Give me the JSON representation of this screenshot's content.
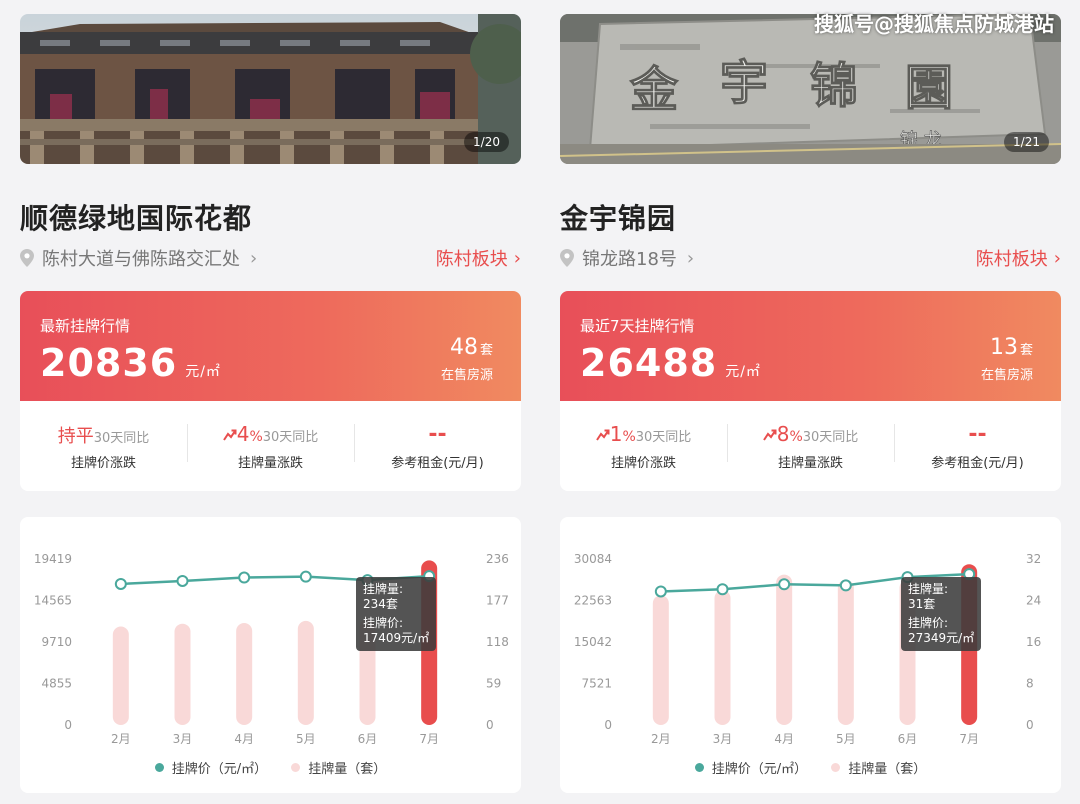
{
  "watermark": "搜狐号@搜狐焦点防城港站",
  "colors": {
    "accent": "#e84e4e",
    "line": "#4aa89c",
    "bar": "#f9d9d8",
    "bar_active": "#e84d4d"
  },
  "listings": [
    {
      "photo_counter": "1/20",
      "name": "顺德绿地国际花都",
      "address": "陈村大道与佛陈路交汇处",
      "district": "陈村板块",
      "stats": {
        "label": "最新挂牌行情",
        "price": "20836",
        "price_unit": "元/㎡",
        "count": "48",
        "count_unit": "套",
        "count_label": "在售房源",
        "metrics": [
          {
            "value": "持平",
            "note": "30天同比",
            "label": "挂牌价涨跌"
          },
          {
            "value": "4",
            "pct": "%",
            "note": "30天同比",
            "label": "挂牌量涨跌"
          },
          {
            "value": "--",
            "label": "参考租金(元/月)"
          }
        ]
      },
      "tooltip": {
        "count_title": "挂牌量:",
        "count_value": "234套",
        "price_title": "挂牌价:",
        "price_value": "17409元/㎡"
      },
      "legend": {
        "price": "挂牌价（元/㎡）",
        "count": "挂牌量（套）"
      }
    },
    {
      "photo_counter": "1/21",
      "name": "金宇锦园",
      "address": "锦龙路18号",
      "district": "陈村板块",
      "stats": {
        "label": "最近7天挂牌行情",
        "price": "26488",
        "price_unit": "元/㎡",
        "count": "13",
        "count_unit": "套",
        "count_label": "在售房源",
        "metrics": [
          {
            "value": "1",
            "pct": "%",
            "note": "30天同比",
            "label": "挂牌价涨跌"
          },
          {
            "value": "8",
            "pct": "%",
            "note": "30天同比",
            "label": "挂牌量涨跌"
          },
          {
            "value": "--",
            "label": "参考租金(元/月)"
          }
        ]
      },
      "tooltip": {
        "count_title": "挂牌量:",
        "count_value": "31套",
        "price_title": "挂牌价:",
        "price_value": "27349元/㎡"
      },
      "legend": {
        "price": "挂牌价（元/㎡）",
        "count": "挂牌量（套）"
      }
    }
  ],
  "chart_data": [
    {
      "type": "bar",
      "categories": [
        "2月",
        "3月",
        "4月",
        "5月",
        "6月",
        "7月"
      ],
      "series": [
        {
          "name": "挂牌价（元/㎡）",
          "type": "line",
          "axis": "left",
          "values": [
            16500,
            16850,
            17250,
            17350,
            16950,
            17409
          ]
        },
        {
          "name": "挂牌量（套）",
          "type": "bar",
          "axis": "right",
          "values": [
            140,
            144,
            145,
            148,
            150,
            234
          ]
        }
      ],
      "left_ticks": [
        "0",
        "4855",
        "9710",
        "14565",
        "19419"
      ],
      "right_ticks": [
        "0",
        "59",
        "118",
        "177",
        "236"
      ],
      "ylim_left": [
        0,
        19419
      ],
      "ylim_right": [
        0,
        236
      ],
      "highlight_index": 5,
      "legend": "bottom"
    },
    {
      "type": "bar",
      "categories": [
        "2月",
        "3月",
        "4月",
        "5月",
        "6月",
        "7月"
      ],
      "series": [
        {
          "name": "挂牌价（元/㎡）",
          "type": "line",
          "axis": "left",
          "values": [
            24200,
            24600,
            25500,
            25300,
            26800,
            27349
          ]
        },
        {
          "name": "挂牌量（套）",
          "type": "bar",
          "axis": "right",
          "values": [
            25,
            26,
            29,
            28,
            28,
            31
          ]
        }
      ],
      "left_ticks": [
        "0",
        "7521",
        "15042",
        "22563",
        "30084"
      ],
      "right_ticks": [
        "0",
        "8",
        "16",
        "24",
        "32"
      ],
      "ylim_left": [
        0,
        30084
      ],
      "ylim_right": [
        0,
        32
      ],
      "highlight_index": 5,
      "legend": "bottom"
    }
  ]
}
